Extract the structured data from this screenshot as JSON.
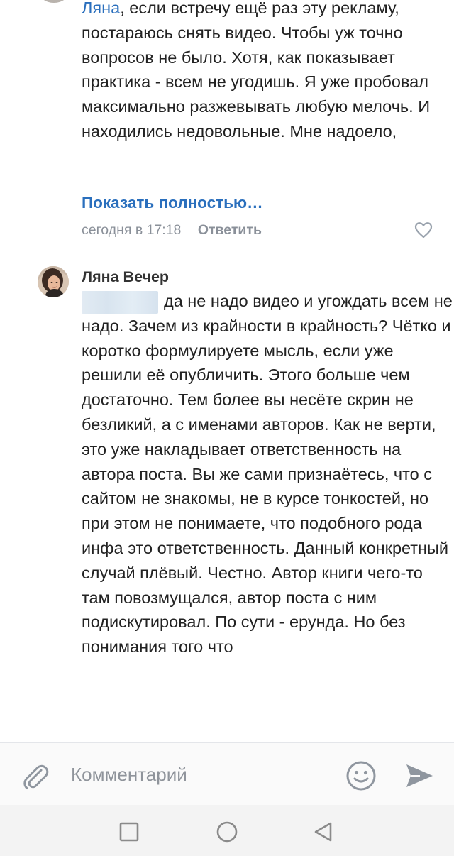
{
  "comment1": {
    "mention": "Ляна",
    "text_after_mention": ", если встречу ещё раз эту рекламу, постараюсь снять видео. Чтобы уж точно вопросов не было. Хотя, как показывает практика - всем не угодишь. Я уже пробовал максимально разжевывать любую мелочь. И находились недовольные. Мне надоело,",
    "show_more": "Показать полностью…",
    "time": "сегодня в 17:18",
    "reply": "Ответить"
  },
  "comment2": {
    "author": "Ляна Вечер",
    "text": "да не надо видео и угождать всем не надо. Зачем из крайности в крайность? Чётко и коротко формулируете мысль, если уже решили её опубличить. Этого больше чем достаточно. Тем более вы несёте скрин не безликий, а с именами авторов. Как не верти, это уже накладывает ответственность на автора поста. Вы же сами признаётесь, что с сайтом не знакомы, не в курсе тонкостей, но при этом не понимаете, что подобного рода инфа это ответственность. Данный конкретный случай плёвый. Честно. Автор книги чего-то там повозмущался, автор поста с ним подискутировал. По сути - ерунда. Но без понимания того что"
  },
  "composer": {
    "placeholder": "Комментарий"
  },
  "icons": {
    "attach": "paperclip-icon",
    "emoji": "smiley-icon",
    "send": "send-icon",
    "like": "heart-icon",
    "nav_recents": "square-icon",
    "nav_home": "circle-icon",
    "nav_back": "triangle-back-icon"
  },
  "colors": {
    "link": "#2a6fbd",
    "meta": "#8a9099",
    "icon": "#99a2ad"
  }
}
